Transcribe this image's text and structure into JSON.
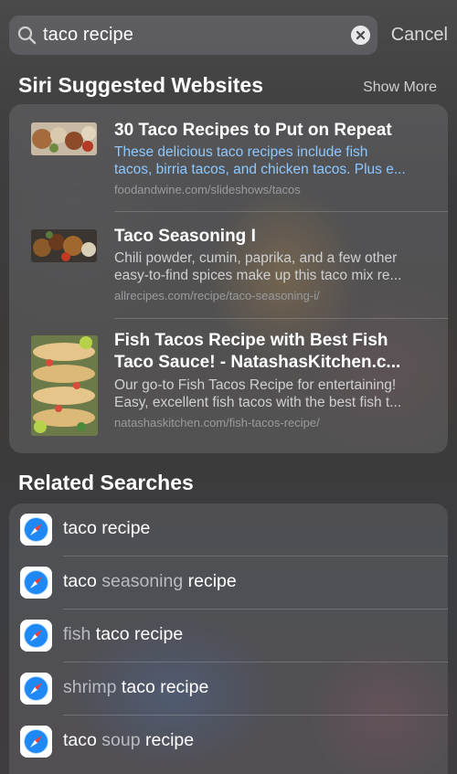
{
  "search": {
    "query": "taco recipe",
    "cancel_label": "Cancel"
  },
  "suggested": {
    "title": "Siri Suggested Websites",
    "show_more_label": "Show More",
    "items": [
      {
        "title": "30 Taco Recipes to Put on Repeat",
        "desc_line1": "These delicious taco recipes include fish",
        "desc_line2": "tacos, birria tacos, and chicken tacos. Plus e...",
        "url": "foodandwine.com/slideshows/tacos"
      },
      {
        "title": "Taco Seasoning I",
        "desc_line1": "Chili powder, cumin, paprika, and a few other",
        "desc_line2": "easy-to-find spices make up this taco mix re...",
        "url": "allrecipes.com/recipe/taco-seasoning-i/"
      },
      {
        "title_line1": "Fish Tacos Recipe with Best Fish",
        "title_line2": "Taco Sauce! - NatashasKitchen.c...",
        "desc_line1": "Our go-to Fish Tacos Recipe for entertaining!",
        "desc_line2": "Easy, excellent fish tacos with the best fish t...",
        "url": "natashaskitchen.com/fish-tacos-recipe/"
      }
    ]
  },
  "related": {
    "title": "Related Searches",
    "items": [
      {
        "pre": "",
        "dim": "",
        "post": "taco recipe"
      },
      {
        "pre": "taco ",
        "dim": "seasoning",
        "post": " recipe"
      },
      {
        "pre": "",
        "dim": "fish",
        "post": " taco recipe"
      },
      {
        "pre": "",
        "dim": "shrimp",
        "post": " taco recipe"
      },
      {
        "pre": "taco ",
        "dim": "soup",
        "post": " recipe"
      }
    ]
  },
  "colors": {
    "accent_blue": "#8cc8ff",
    "safari_blue": "#1e88f5"
  }
}
